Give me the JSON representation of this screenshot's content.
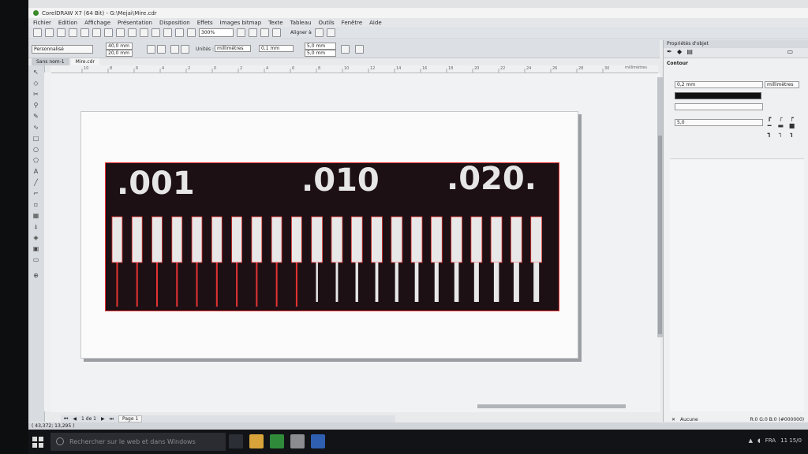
{
  "window": {
    "title": "CorelDRAW X7 (64 Bit) - G:\\Mejai\\Mire.cdr"
  },
  "menu": [
    "Fichier",
    "Edition",
    "Affichage",
    "Présentation",
    "Disposition",
    "Effets",
    "Images bitmap",
    "Texte",
    "Tableau",
    "Outils",
    "Fenêtre",
    "Aide"
  ],
  "toolbar": {
    "zoom": "300%",
    "align_label": "Aligner à"
  },
  "propbar": {
    "preset": "Personnalisé",
    "width": "40,0 mm",
    "height": "20,0 mm",
    "units_label": "Unités :",
    "units": "millimètres",
    "nudge": "0,1 mm",
    "dup_x": "5,0 mm",
    "dup_y": "5,0 mm"
  },
  "tabs": [
    "Sans nom-1",
    "Mire.cdr"
  ],
  "ruler": {
    "ticks": [
      "10",
      "8",
      "6",
      "4",
      "2",
      "0",
      "2",
      "4",
      "6",
      "8",
      "10",
      "12",
      "14",
      "16",
      "18",
      "20",
      "22",
      "24",
      "26",
      "28",
      "30"
    ],
    "unit": "millimètres"
  },
  "mire": {
    "labels": [
      ".001",
      ".010",
      ".020."
    ],
    "colors": {
      "background": "#1d1014",
      "bars": "#e8e8e8",
      "outline": "#e33333"
    }
  },
  "docker": {
    "title": "Propriétés d'objet",
    "section": "Contour",
    "width": "0,2 mm",
    "units": "millimètres",
    "miter": "5,0"
  },
  "pagenav": {
    "counter": "1 de 1",
    "page": "Page 1"
  },
  "status": {
    "coords": "( 43,372; 13,295 )",
    "fill": "Aucune",
    "outline": "R:0 G:0 B:0 (#000000)"
  },
  "taskbar": {
    "search_placeholder": "Rechercher sur le web et dans Windows",
    "lang": "FRA",
    "time": "11",
    "date": "15/0"
  }
}
